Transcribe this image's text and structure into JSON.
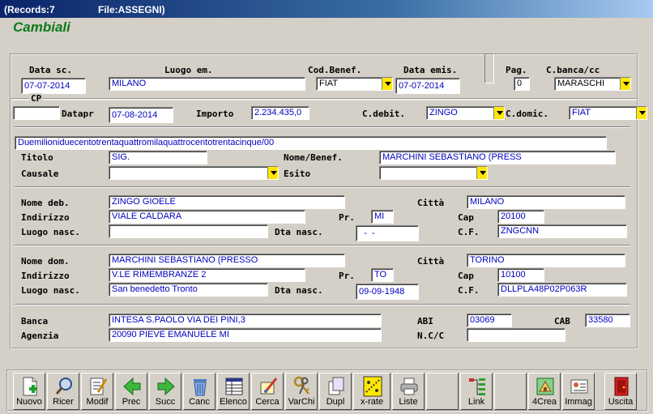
{
  "titlebar": {
    "records": "(Records:7",
    "file": "File:ASSEGNI)"
  },
  "form_title": "Cambiali",
  "row1": {
    "data_sc_label": "Data sc.",
    "data_sc": "07-07-2014",
    "luogo_em_label": "Luogo em.",
    "luogo_em": "MILANO",
    "cod_benef_label": "Cod.Benef.",
    "cod_benef": "FIAT",
    "data_emis_label": "Data emis.",
    "data_emis": "07-07-2014",
    "pag_label": "Pag.",
    "pag": "0",
    "c_banca_label": "C.banca/cc",
    "c_banca": "MARASCHI"
  },
  "row2": {
    "cp_label": "CP",
    "cp": "",
    "datapr_label": "Datapr",
    "datapr": "07-08-2014",
    "importo_label": "Importo",
    "importo": "2.234.435,0",
    "c_debit_label": "C.debit.",
    "c_debit": "ZINGO",
    "c_domic_label": "C.domic.",
    "c_domic": "FIAT"
  },
  "words": "Duemilioniduecentotrentaquattromilaquattrocentotrentacinque/00",
  "section1": {
    "titolo_label": "Titolo",
    "titolo": "SIG.",
    "nome_benef_label": "Nome/Benef.",
    "nome_benef": "MARCHINI SEBASTIANO (PRESS",
    "causale_label": "Causale",
    "causale": "",
    "esito_label": "Esito",
    "esito": ""
  },
  "debitore": {
    "nome_label": "Nome deb.",
    "nome": "ZINGO GIOELE",
    "citta_label": "Città",
    "citta": "MILANO",
    "indirizzo_label": "Indirizzo",
    "indirizzo": "VIALE CALDARA",
    "pr_label": "Pr.",
    "pr": "MI",
    "cap_label": "Cap",
    "cap": "20100",
    "luogo_nasc_label": "Luogo nasc.",
    "luogo_nasc": "",
    "dta_nasc_label": "Dta nasc.",
    "dta_nasc": "  -  -",
    "cf_label": "C.F.",
    "cf": "ZNGCNN"
  },
  "domicilio": {
    "nome_label": "Nome dom.",
    "nome": "MARCHINI SEBASTIANO (PRESSO",
    "citta_label": "Città",
    "citta": "TORINO",
    "indirizzo_label": "Indirizzo",
    "indirizzo": "V.LE RIMEMBRANZE 2",
    "pr_label": "Pr.",
    "pr": "TO",
    "cap_label": "Cap",
    "cap": "10100",
    "luogo_nasc_label": "Luogo nasc.",
    "luogo_nasc": "San benedetto Tronto",
    "dta_nasc_label": "Dta nasc.",
    "dta_nasc": "09-09-1948",
    "cf_label": "C.F.",
    "cf": "DLLPLA48P02P063R"
  },
  "banca": {
    "banca_label": "Banca",
    "banca": "INTESA S.PAOLO VIA DEI PINI,3",
    "abi_label": "ABI",
    "abi": "03069",
    "cab_label": "CAB",
    "cab": "33580",
    "agenzia_label": "Agenzia",
    "agenzia": "20090 PIEVE EMANUELE MI",
    "ncc_label": "N.C/C",
    "ncc": ""
  },
  "toolbar": {
    "nuovo": "Nuovo",
    "ricer": "Ricer",
    "modif": "Modif",
    "prec": "Prec",
    "succ": "Succ",
    "canc": "Canc",
    "elenco": "Elenco",
    "cerca": "Cerca",
    "varchi": "VarChi",
    "dupl": "Dupl",
    "xrate": "x-rate",
    "liste": "Liste",
    "link": "Link",
    "crea4": "4Crea",
    "immag": "Immag",
    "uscita": "Uscita"
  },
  "icons": {
    "nuovo": "new-document-icon",
    "ricer": "magnifier-icon",
    "modif": "edit-document-icon",
    "prec": "arrow-left-icon",
    "succ": "arrow-right-icon",
    "canc": "trash-icon",
    "elenco": "grid-list-icon",
    "cerca": "search-pen-icon",
    "varchi": "keys-icon",
    "dupl": "duplicate-icon",
    "xrate": "x-rate-icon",
    "liste": "printer-icon",
    "link": "link-tree-icon",
    "crea4": "create-icon",
    "immag": "image-card-icon",
    "uscita": "exit-door-icon"
  },
  "colors": {
    "title_green": "#0a7a1a",
    "field_text": "#0000c0",
    "dropdown": "#ffe800",
    "window_bg": "#d4d0c8"
  }
}
